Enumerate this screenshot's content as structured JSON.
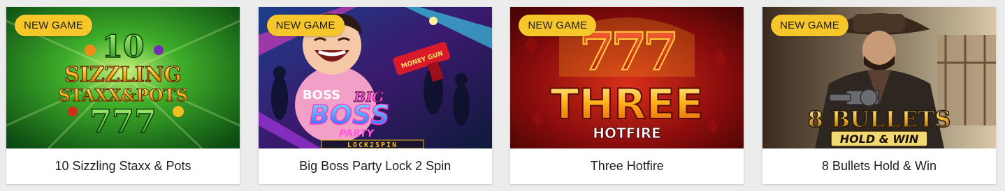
{
  "colors": {
    "page_background": "#ececec",
    "badge_background": "#f7c62a",
    "card_background": "#ffffff",
    "caption_text": "#222222"
  },
  "games": [
    {
      "badge": "NEW GAME",
      "title": "10 Sizzling Staxx & Pots",
      "art": {
        "number": "10",
        "line1": "SIZZLING",
        "line2": "STAXX&POTS",
        "line3": "777"
      }
    },
    {
      "badge": "NEW GAME",
      "title": "Big Boss Party Lock 2 Spin",
      "art": {
        "gun_label": "MONEY GUN",
        "shirt_text": "BOSS",
        "logo_big": "BIG",
        "logo_boss": "BOSS",
        "logo_party": "PARTY",
        "logo_lock": "LOCK2SPIN"
      }
    },
    {
      "badge": "NEW GAME",
      "title": "Three Hotfire",
      "art": {
        "sevens": "777",
        "logo_main": "THREE",
        "logo_sub": "HOTFIRE"
      }
    },
    {
      "badge": "NEW GAME",
      "title": "8 Bullets Hold & Win",
      "art": {
        "logo_main": "8 BULLETS",
        "logo_sub": "HOLD & WIN"
      }
    }
  ]
}
